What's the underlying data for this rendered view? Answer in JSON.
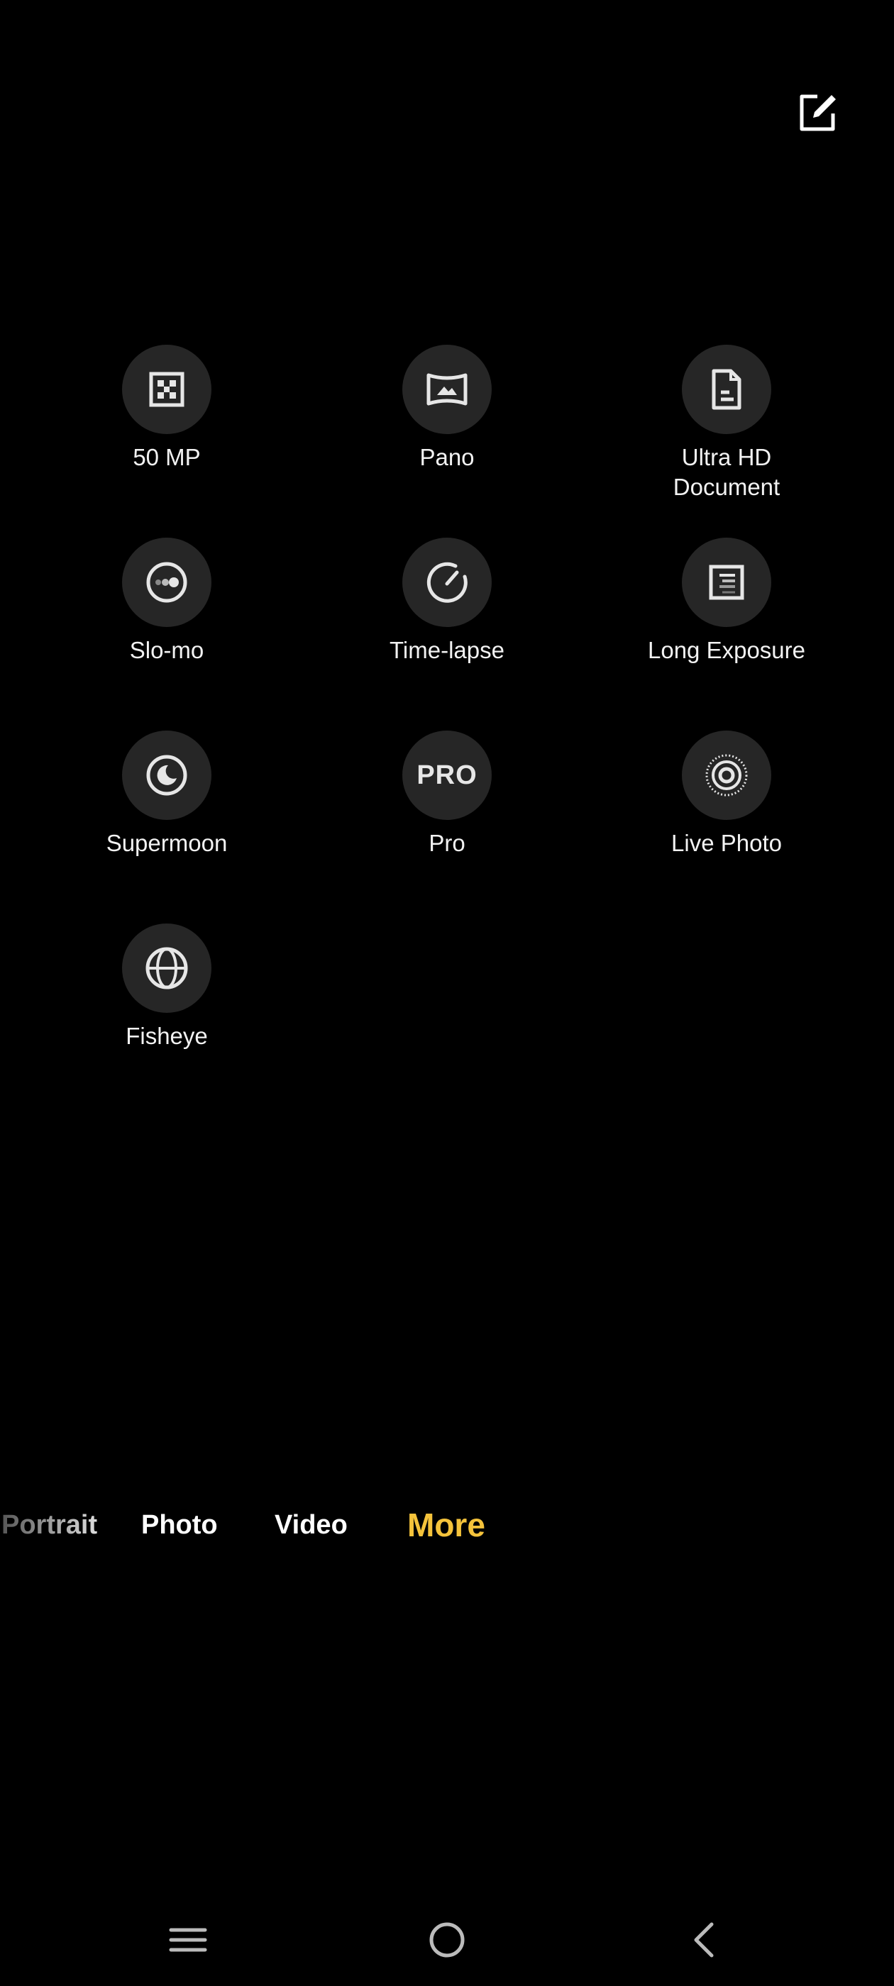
{
  "header": {
    "edit_icon": "edit-icon"
  },
  "modes": [
    {
      "label": "50 MP",
      "icon": "grid-dots-icon"
    },
    {
      "label": "Pano",
      "icon": "panorama-icon"
    },
    {
      "label": "Ultra HD\nDocument",
      "icon": "document-icon"
    },
    {
      "label": "Slo-mo",
      "icon": "slow-motion-icon"
    },
    {
      "label": "Time-lapse",
      "icon": "timer-dial-icon"
    },
    {
      "label": "Long Exposure",
      "icon": "long-exposure-icon"
    },
    {
      "label": "Supermoon",
      "icon": "moon-icon"
    },
    {
      "label": "Pro",
      "icon": "pro-icon",
      "icon_text": "PRO"
    },
    {
      "label": "Live Photo",
      "icon": "live-photo-icon"
    },
    {
      "label": "Fisheye",
      "icon": "globe-icon"
    }
  ],
  "mode_bar": {
    "tabs": [
      "Portrait",
      "Photo",
      "Video",
      "More"
    ],
    "active": "More",
    "active_color": "#f5c33b"
  },
  "navbar": {
    "items": [
      "menu-icon",
      "home-icon",
      "back-icon"
    ]
  }
}
